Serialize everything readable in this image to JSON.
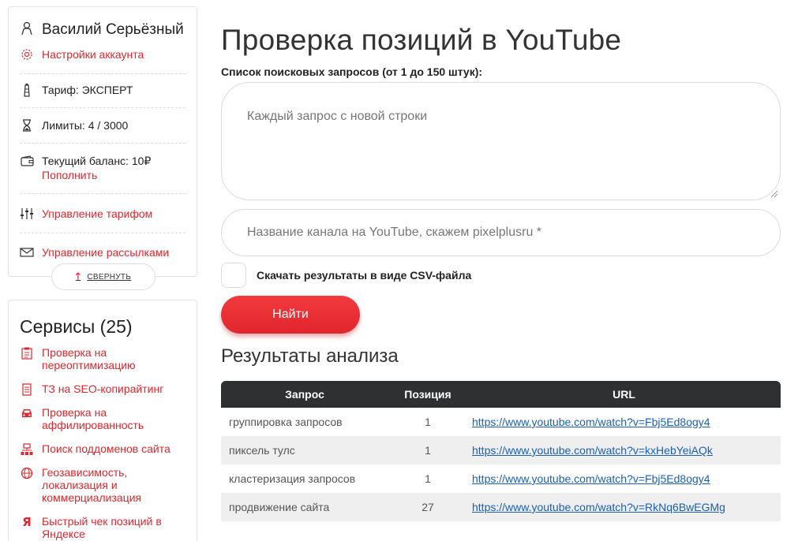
{
  "account": {
    "user_name": "Василий Серьёзный",
    "settings_link": "Настройки аккаунта",
    "tariff": "Тариф: ЭКСПЕРТ",
    "limits": "Лимиты: 4 / 3000",
    "balance": "Текущий баланс: 10₽",
    "top_up_link": "Пополнить",
    "manage_tariff_link": "Управление тарифом",
    "manage_mailing_link": "Управление рассылками",
    "collapse_label": "СВЕРНУТЬ"
  },
  "services": {
    "title": "Сервисы (25)",
    "items": [
      {
        "label": "Проверка на переоптимизацию",
        "icon": "checklist-icon"
      },
      {
        "label": "ТЗ на SEO-копирайтинг",
        "icon": "document-icon"
      },
      {
        "label": "Проверка на аффилированность",
        "icon": "car-icon"
      },
      {
        "label": "Поиск поддоменов сайта",
        "icon": "sitemap-icon"
      },
      {
        "label": "Геозависимость, локализация и коммерциализация",
        "icon": "globe-icon"
      },
      {
        "label": "Быстрый чек позиций в Яндексе",
        "icon": "yandex-icon"
      }
    ]
  },
  "main": {
    "title": "Проверка позиций в YouTube",
    "queries_label": "Список поисковых запросов (от 1 до 150 штук):",
    "queries_placeholder": "Каждый запрос с новой строки",
    "channel_placeholder": "Название канала на YouTube, скажем pixelplusru *",
    "csv_label": "Скачать результаты в виде CSV-файла",
    "find_button": "Найти",
    "results_title": "Результаты анализа"
  },
  "results": {
    "headers": {
      "query": "Запрос",
      "position": "Позиция",
      "url": "URL"
    },
    "rows": [
      {
        "query": "группировка запросов",
        "position": "1",
        "url": "https://www.youtube.com/watch?v=Fbj5Ed8ogy4"
      },
      {
        "query": "пиксель тулс",
        "position": "1",
        "url": "https://www.youtube.com/watch?v=kxHebYeiAQk"
      },
      {
        "query": "кластеризация запросов",
        "position": "1",
        "url": "https://www.youtube.com/watch?v=Fbj5Ed8ogy4"
      },
      {
        "query": "продвижение сайта",
        "position": "27",
        "url": "https://www.youtube.com/watch?v=RkNq6BwEGMg"
      }
    ]
  },
  "colors": {
    "accent": "#e0262c",
    "table_header": "#2f3032",
    "link": "#1a5fb4"
  }
}
